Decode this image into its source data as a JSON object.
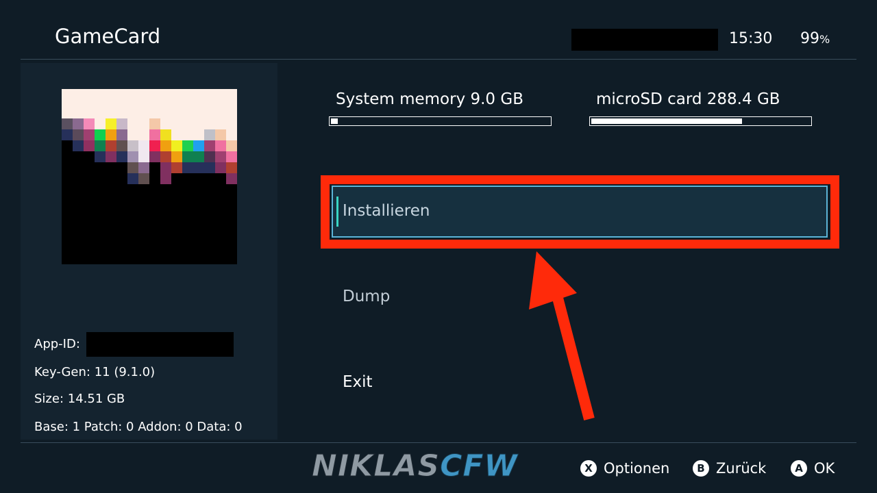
{
  "header": {
    "title": "GameCard",
    "time": "15:30",
    "battery_value": "99",
    "battery_unit": "%"
  },
  "storage": {
    "system": {
      "label": "System memory 9.0 GB",
      "used_fraction": 0.03
    },
    "sd": {
      "label": "microSD card 288.4 GB",
      "used_fraction": 0.69
    }
  },
  "info": {
    "app_id_label": "App-ID:",
    "keygen": "Key-Gen: 11 (9.1.0)",
    "size": "Size: 14.51 GB",
    "contents": "Base: 1 Patch: 0 Addon: 0 Data: 0"
  },
  "menu": {
    "items": [
      {
        "label": "Installieren",
        "selected": true,
        "color": "#c8d6e0"
      },
      {
        "label": "Dump",
        "selected": false,
        "color": "#c2cdd6"
      },
      {
        "label": "Exit",
        "selected": false,
        "color": "#ffffff"
      }
    ]
  },
  "footer": {
    "logo_part1": "NIKLAS",
    "logo_part2": "CFW",
    "hints": [
      {
        "button": "X",
        "label": "Optionen"
      },
      {
        "button": "B",
        "label": "Zurück"
      },
      {
        "button": "A",
        "label": "OK"
      }
    ]
  },
  "colors": {
    "background": "#0f1c26",
    "panel": "#14232f",
    "selection_border": "#5bb5d8",
    "selection_cursor": "#39d6c4",
    "annotation_red": "#ff2a0a"
  },
  "icons": {
    "game_icon": "pixel-art-icon",
    "arrow": "red-annotation-arrow"
  }
}
